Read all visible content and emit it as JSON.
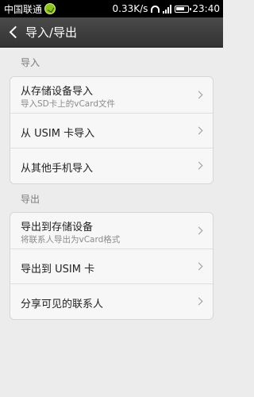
{
  "status_bar": {
    "carrier": "中国联通",
    "speed": "0.33K/s",
    "time": "23:40"
  },
  "title_bar": {
    "title": "导入/导出"
  },
  "import_section": {
    "label": "导入",
    "items": [
      {
        "title": "从存储设备导入",
        "subtitle": "导入SD卡上的vCard文件"
      },
      {
        "title": "从 USIM 卡导入"
      },
      {
        "title": "从其他手机导入"
      }
    ]
  },
  "export_section": {
    "label": "导出",
    "items": [
      {
        "title": "导出到存储设备",
        "subtitle": "将联系人导出为vCard格式"
      },
      {
        "title": "导出到 USIM 卡"
      },
      {
        "title": "分享可见的联系人"
      }
    ]
  }
}
